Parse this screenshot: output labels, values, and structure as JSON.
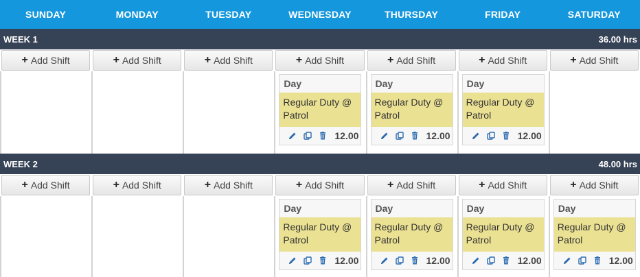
{
  "days": [
    "SUNDAY",
    "MONDAY",
    "TUESDAY",
    "WEDNESDAY",
    "THURSDAY",
    "FRIDAY",
    "SATURDAY"
  ],
  "add_shift_label": "Add Shift",
  "weeks": [
    {
      "label": "WEEK 1",
      "total": "36.00 hrs",
      "shifts": [
        null,
        null,
        null,
        {
          "type": "Day",
          "title": "Regular Duty @ Patrol",
          "hours": "12.00"
        },
        {
          "type": "Day",
          "title": "Regular Duty @ Patrol",
          "hours": "12.00"
        },
        {
          "type": "Day",
          "title": "Regular Duty @ Patrol",
          "hours": "12.00"
        },
        null
      ]
    },
    {
      "label": "WEEK 2",
      "total": "48.00 hrs",
      "shifts": [
        null,
        null,
        null,
        {
          "type": "Day",
          "title": "Regular Duty @ Patrol",
          "hours": "12.00"
        },
        {
          "type": "Day",
          "title": "Regular Duty @ Patrol",
          "hours": "12.00"
        },
        {
          "type": "Day",
          "title": "Regular Duty @ Patrol",
          "hours": "12.00"
        },
        {
          "type": "Day",
          "title": "Regular Duty @ Patrol",
          "hours": "12.00"
        }
      ]
    }
  ],
  "colors": {
    "header_blue": "#1497dd",
    "week_bar": "#364255",
    "shift_yellow": "#ebe193",
    "icon_blue": "#2b6cb0"
  }
}
